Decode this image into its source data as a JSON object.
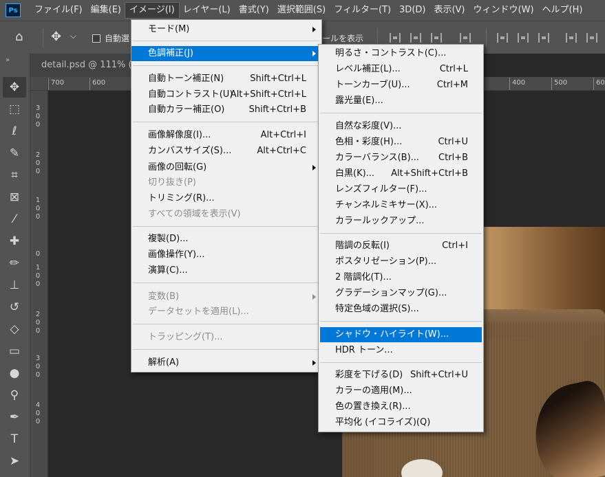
{
  "app": {
    "logo": "Ps"
  },
  "menubar": {
    "items": [
      "ファイル(F)",
      "編集(E)",
      "イメージ(I)",
      "レイヤー(L)",
      "書式(Y)",
      "選択範囲(S)",
      "フィルター(T)",
      "3D(D)",
      "表示(V)",
      "ウィンドウ(W)",
      "ヘルプ(H)"
    ],
    "active_index": 2
  },
  "options": {
    "auto_select_label": "自動選",
    "show_transform_label": "ールを表示",
    "icons": [
      "home-icon",
      "move-icon",
      "chevron-down-icon"
    ]
  },
  "document": {
    "tab_label": "detail.psd @ 111% (",
    "ruler_h_labels": [
      "700",
      "600",
      "400",
      "500",
      "600"
    ],
    "ruler_v_labels": [
      "300",
      "200",
      "100",
      "0",
      "100",
      "200",
      "300",
      "400"
    ]
  },
  "image_menu": {
    "items": [
      {
        "label": "モード(M)",
        "shortcut": "",
        "submenu": true,
        "disabled": false
      },
      {
        "label": "色調補正(J)",
        "shortcut": "",
        "submenu": true,
        "disabled": false,
        "highlighted": true
      },
      {
        "label": "自動トーン補正(N)",
        "shortcut": "Shift+Ctrl+L",
        "disabled": false
      },
      {
        "label": "自動コントラスト(U)",
        "shortcut": "Alt+Shift+Ctrl+L",
        "disabled": false
      },
      {
        "label": "自動カラー補正(O)",
        "shortcut": "Shift+Ctrl+B",
        "disabled": false
      },
      {
        "label": "画像解像度(I)...",
        "shortcut": "Alt+Ctrl+I",
        "disabled": false
      },
      {
        "label": "カンバスサイズ(S)...",
        "shortcut": "Alt+Ctrl+C",
        "disabled": false
      },
      {
        "label": "画像の回転(G)",
        "shortcut": "",
        "submenu": true,
        "disabled": false
      },
      {
        "label": "切り抜き(P)",
        "shortcut": "",
        "disabled": true
      },
      {
        "label": "トリミング(R)...",
        "shortcut": "",
        "disabled": false
      },
      {
        "label": "すべての領域を表示(V)",
        "shortcut": "",
        "disabled": true
      },
      {
        "label": "複製(D)...",
        "shortcut": "",
        "disabled": false
      },
      {
        "label": "画像操作(Y)...",
        "shortcut": "",
        "disabled": false
      },
      {
        "label": "演算(C)...",
        "shortcut": "",
        "disabled": false
      },
      {
        "label": "変数(B)",
        "shortcut": "",
        "submenu": true,
        "disabled": true
      },
      {
        "label": "データセットを適用(L)...",
        "shortcut": "",
        "disabled": true
      },
      {
        "label": "トラッピング(T)...",
        "shortcut": "",
        "disabled": true
      },
      {
        "label": "解析(A)",
        "shortcut": "",
        "submenu": true,
        "disabled": false
      }
    ]
  },
  "adjust_menu": {
    "items": [
      {
        "label": "明るさ・コントラスト(C)...",
        "shortcut": ""
      },
      {
        "label": "レベル補正(L)...",
        "shortcut": "Ctrl+L"
      },
      {
        "label": "トーンカーブ(U)...",
        "shortcut": "Ctrl+M"
      },
      {
        "label": "露光量(E)...",
        "shortcut": ""
      },
      {
        "label": "自然な彩度(V)...",
        "shortcut": ""
      },
      {
        "label": "色相・彩度(H)...",
        "shortcut": "Ctrl+U"
      },
      {
        "label": "カラーバランス(B)...",
        "shortcut": "Ctrl+B"
      },
      {
        "label": "白黒(K)...",
        "shortcut": "Alt+Shift+Ctrl+B"
      },
      {
        "label": "レンズフィルター(F)...",
        "shortcut": ""
      },
      {
        "label": "チャンネルミキサー(X)...",
        "shortcut": ""
      },
      {
        "label": "カラールックアップ...",
        "shortcut": ""
      },
      {
        "label": "階調の反転(I)",
        "shortcut": "Ctrl+I"
      },
      {
        "label": "ポスタリゼーション(P)...",
        "shortcut": ""
      },
      {
        "label": "2 階調化(T)...",
        "shortcut": ""
      },
      {
        "label": "グラデーションマップ(G)...",
        "shortcut": ""
      },
      {
        "label": "特定色域の選択(S)...",
        "shortcut": ""
      },
      {
        "label": "シャドウ・ハイライト(W)...",
        "shortcut": "",
        "highlighted": true
      },
      {
        "label": "HDR トーン...",
        "shortcut": ""
      },
      {
        "label": "彩度を下げる(D)",
        "shortcut": "Shift+Ctrl+U"
      },
      {
        "label": "カラーの適用(M)...",
        "shortcut": ""
      },
      {
        "label": "色の置き換え(R)...",
        "shortcut": ""
      },
      {
        "label": "平均化 (イコライズ)(Q)",
        "shortcut": ""
      }
    ]
  },
  "colors": {
    "menu_bg": "#f0f0f0",
    "highlight": "#0078d7",
    "app_bg": "#535353",
    "canvas_bg": "#282828"
  }
}
